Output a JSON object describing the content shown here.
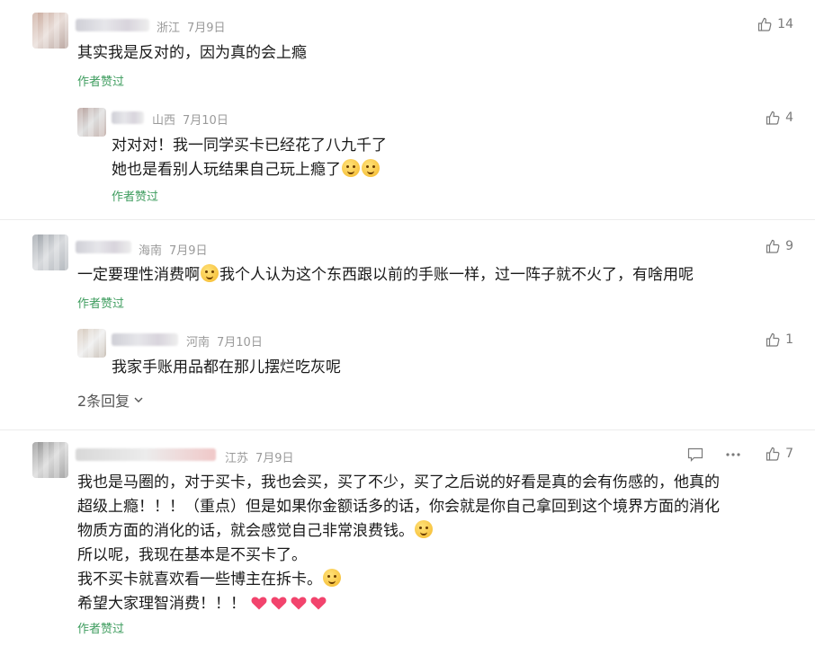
{
  "comments": [
    {
      "region": "浙江",
      "date": "7月9日",
      "likes": "14",
      "lines": [
        "其实我是反对的，因为真的会上瘾"
      ],
      "author_liked": "作者赞过"
    },
    {
      "region": "山西",
      "date": "7月10日",
      "likes": "4",
      "lines": [
        "对对对！我一同学买卡已经花了八九千了",
        "她也是看别人玩结果自己玩上瘾了"
      ],
      "author_liked": "作者赞过"
    },
    {
      "region": "海南",
      "date": "7月9日",
      "likes": "9",
      "lines_a": "一定要理性消费啊",
      "lines_b": "我个人认为这个东西跟以前的手账一样，过一阵子就不火了，有啥用呢",
      "author_liked": "作者赞过"
    },
    {
      "region": "河南",
      "date": "7月10日",
      "likes": "1",
      "lines": [
        "我家手账用品都在那儿摆烂吃灰呢"
      ]
    },
    {
      "more_replies": "2条回复"
    },
    {
      "region": "江苏",
      "date": "7月9日",
      "likes": "7",
      "lines": [
        "我也是马圈的，对于买卡，我也会买，买了不少，买了之后说的好看是真的会有伤感的，他真的",
        "超级上瘾！！！（重点）但是如果你金额话多的话，你会就是你自己拿回到这个境界方面的消化",
        "物质方面的消化的话，就会感觉自己非常浪费钱。",
        "所以呢，我现在基本是不买卡了。",
        "我不买卡就喜欢看一些博主在拆卡。",
        "希望大家理智消费！！！"
      ],
      "author_liked": "作者赞过"
    }
  ],
  "icons": {
    "like": "thumbs-up-icon",
    "comment": "comment-icon",
    "more": "more-dots-icon",
    "chevron": "chevron-down-icon"
  },
  "colors": {
    "author": "#3f9d5f",
    "meta": "#9a9a9a",
    "heart": "#f2446d"
  }
}
